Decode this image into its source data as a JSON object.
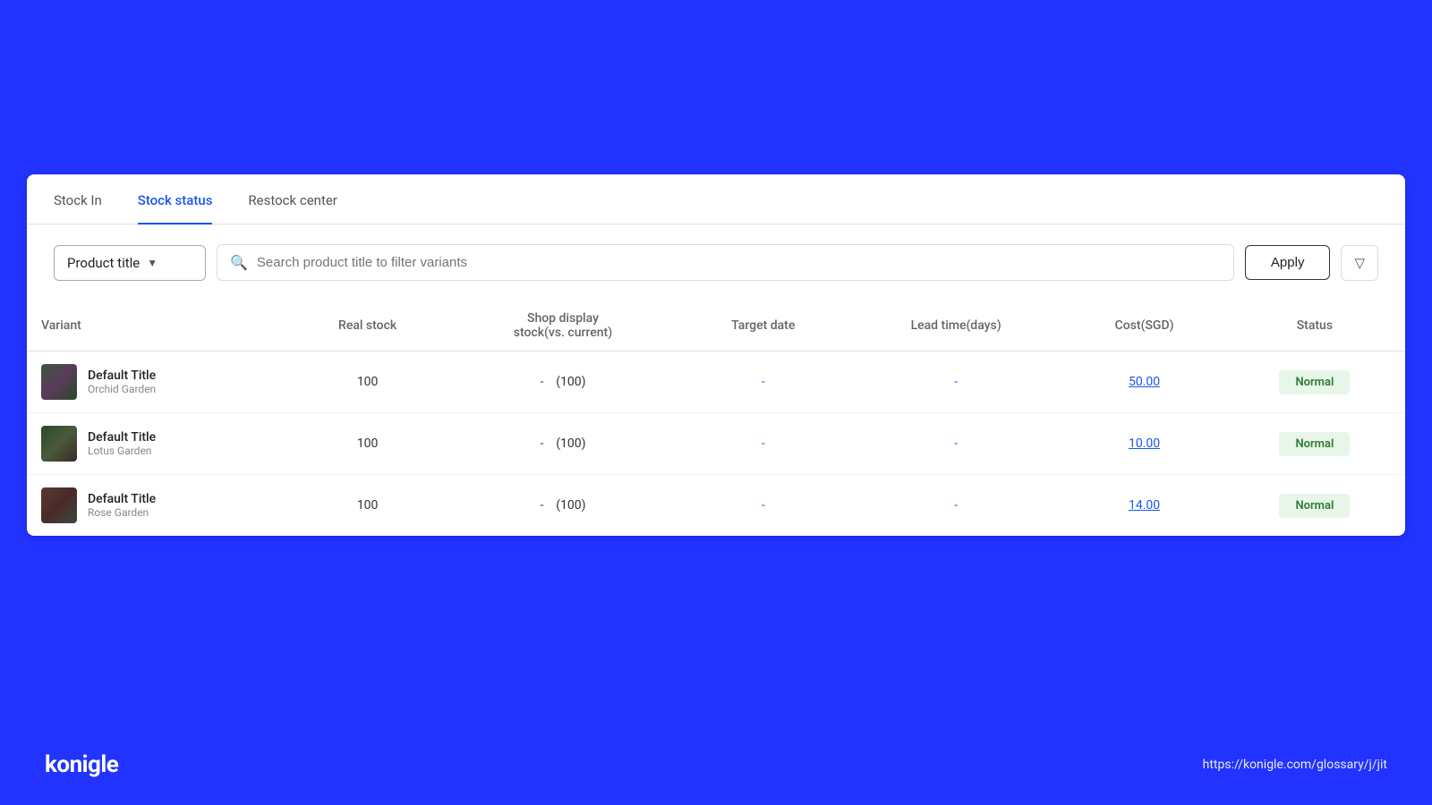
{
  "tabs": [
    {
      "label": "Stock In",
      "active": false
    },
    {
      "label": "Stock status",
      "active": true
    },
    {
      "label": "Restock center",
      "active": false
    }
  ],
  "filter": {
    "dropdown_label": "Product title",
    "search_placeholder": "Search product title to filter variants",
    "apply_label": "Apply"
  },
  "table": {
    "columns": [
      "Variant",
      "Real stock",
      "Shop display stock(vs. current)",
      "Target date",
      "Lead time(days)",
      "Cost(SGD)",
      "Status"
    ],
    "rows": [
      {
        "variant_title": "Default Title",
        "variant_subtitle": "Orchid Garden",
        "real_stock": "100",
        "shop_display": "-",
        "shop_display_vs": "(100)",
        "target_date": "-",
        "lead_time": "-",
        "cost": "50.00",
        "status": "Normal"
      },
      {
        "variant_title": "Default Title",
        "variant_subtitle": "Lotus Garden",
        "real_stock": "100",
        "shop_display": "-",
        "shop_display_vs": "(100)",
        "target_date": "-",
        "lead_time": "-",
        "cost": "10.00",
        "status": "Normal"
      },
      {
        "variant_title": "Default Title",
        "variant_subtitle": "Rose Garden",
        "real_stock": "100",
        "shop_display": "-",
        "shop_display_vs": "(100)",
        "target_date": "-",
        "lead_time": "-",
        "cost": "14.00",
        "status": "Normal"
      }
    ]
  },
  "footer": {
    "logo": "konigle",
    "url": "https://konigle.com/glossary/j/jit"
  }
}
